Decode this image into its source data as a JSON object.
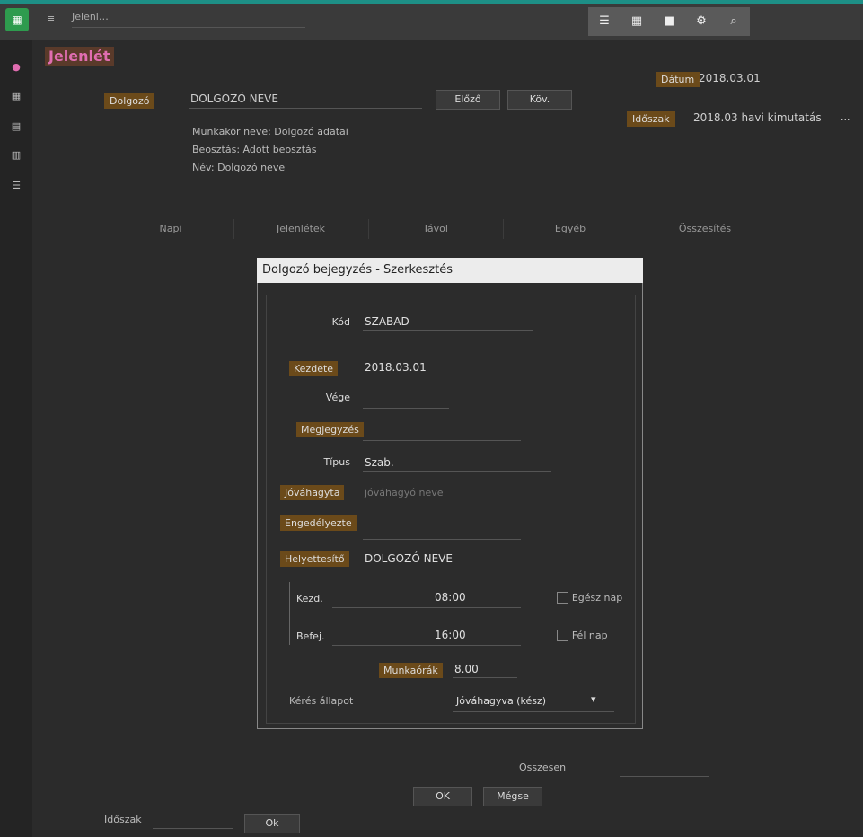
{
  "topbar": {
    "app_icon": "grid-icon",
    "title": "Jelenl…",
    "icons": [
      "list-icon",
      "grid-icon",
      "stop-icon",
      "gear-icon",
      "search-icon"
    ]
  },
  "sidebar": {
    "icons": [
      "home-icon",
      "grid-icon",
      "calendar-icon",
      "chart-icon",
      "list-icon"
    ]
  },
  "header": {
    "title": "Jelenlét",
    "field_label": "Dolgozó",
    "field_value": "DOLGOZÓ NEVE",
    "btn_a": "Előző",
    "btn_b": "Köv.",
    "info_lines": [
      "Munkakör neve: Dolgozó adatai",
      "Beosztás: Adott beosztás",
      "Név: Dolgozó neve"
    ],
    "right_label1": "Dátum",
    "right_val1": "2018.03.01",
    "right_label2": "Időszak",
    "right_val2": "2018.03 havi kimutatás",
    "right_btn": "..."
  },
  "tabs": [
    "Napi",
    "Jelenlétek",
    "Távol",
    "Egyéb",
    "Összesítés"
  ],
  "dialog": {
    "title": "Dolgozó bejegyzés - Szerkesztés",
    "fields": [
      {
        "label": "Kód",
        "value": "SZABAD"
      },
      {
        "label": "Kezdete",
        "value": "2018.03.01"
      },
      {
        "label": "Vége",
        "value": ""
      },
      {
        "label": "Megjegyzés",
        "value": ""
      },
      {
        "label": "Típus",
        "value": "Szab."
      },
      {
        "label": "Jóváhagyta",
        "value": "jóváhagyó neve"
      },
      {
        "label": "Engedélyezte",
        "value": ""
      },
      {
        "label": "Helyettesítő",
        "value": "DOLGOZÓ NEVE"
      }
    ],
    "time_rows": [
      {
        "label": "Kezd.",
        "value": "08:00",
        "check_label": "Egész nap"
      },
      {
        "label": "Befej.",
        "value": "16:00",
        "check_label": "Fél nap"
      }
    ],
    "hours_label": "Munkaórák",
    "hours_value": "8.00",
    "bottom_label": "Kérés állapot",
    "bottom_value": "Jóváhagyva (kész)"
  },
  "footer": {
    "label": "Összesen",
    "value": "",
    "btn_ok": "OK",
    "btn_cancel": "Mégse",
    "left_label": "Időszak",
    "left_btn": "Ok"
  }
}
